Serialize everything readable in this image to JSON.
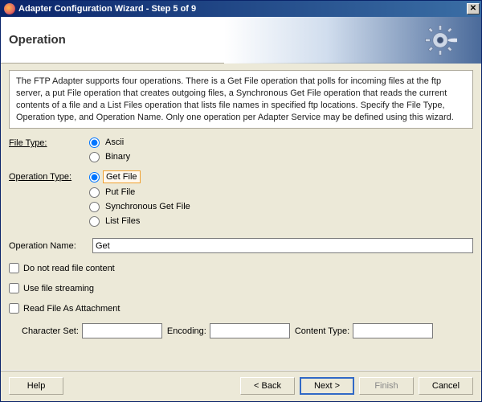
{
  "window": {
    "title": "Adapter Configuration Wizard - Step 5 of 9"
  },
  "header": {
    "title": "Operation"
  },
  "content": {
    "description": "The FTP Adapter supports four operations.  There is a Get File operation that polls for incoming files at the ftp server, a put File operation that creates outgoing files, a Synchronous Get File operation that reads the current contents of a file and a List Files operation that lists file names in specified ftp locations.  Specify the File Type, Operation type, and Operation Name.  Only one operation per Adapter Service may be defined using this wizard.",
    "fileType": {
      "label": "File Type:",
      "options": [
        "Ascii",
        "Binary"
      ],
      "selected": "Ascii"
    },
    "operationType": {
      "label": "Operation Type:",
      "options": [
        "Get File",
        "Put File",
        "Synchronous Get File",
        "List Files"
      ],
      "selected": "Get File"
    },
    "operationName": {
      "label": "Operation Name:",
      "value": "Get"
    },
    "checks": [
      "Do not read file content",
      "Use file streaming",
      "Read File As Attachment"
    ],
    "sub": {
      "charset": "Character Set:",
      "encoding": "Encoding:",
      "contentType": "Content Type:"
    }
  },
  "footer": {
    "help": "Help",
    "back": "< Back",
    "next": "Next >",
    "finish": "Finish",
    "cancel": "Cancel"
  }
}
